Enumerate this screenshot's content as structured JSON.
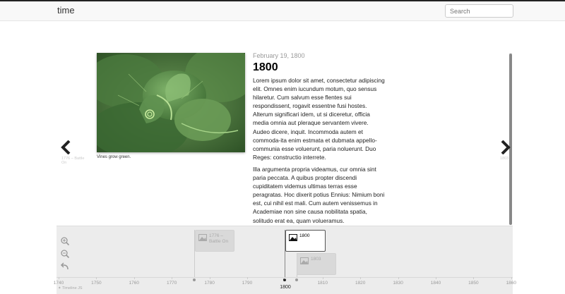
{
  "app": {
    "title": "time"
  },
  "search": {
    "placeholder": "Search"
  },
  "slide": {
    "date": "February 19, 1800",
    "headline": "1800",
    "paragraphs": [
      "Lorem ipsum dolor sit amet, consectetur adipiscing elit. Omnes enim iucundum motum, quo sensus hilaretur. Cum salvum esse flentes sui respondissent, rogavit essentne fusi hostes. Alterum significari idem, ut si diceretur, officia media omnia aut pleraque servantem vivere. Audeo dicere, inquit. Incommoda autem et commoda-ita enim estmata et dubmata appello-communia esse voluerunt, paria noluerunt. Duo Reges: constructio interrete.",
      "Illa argumenta propria videamus, cur omnia sint paria peccata. A quibus propter discendi cupiditatem videmus ultimas terras esse peragratas. Hoc dixerit potius Ennius: Nimium boni est, cui nihil est mali. Cum autem venissemus in Academiae non sine causa nobilitata spatia, solitudo erat ea, quam volueramus."
    ],
    "media_caption": "Vines grow green."
  },
  "navigation": {
    "previous_label": "1776 – Battle On",
    "next_label": "1803"
  },
  "timenav": {
    "tools": [
      "zoom-in-icon",
      "zoom-out-icon",
      "back-to-start-icon"
    ],
    "events": [
      {
        "year": 1776,
        "label": "1776 – Battle On",
        "active": false
      },
      {
        "year": 1800,
        "label": "1800",
        "active": true
      },
      {
        "year": 1803,
        "label": "1803",
        "active": false
      }
    ],
    "axis_ticks": [
      "1740",
      "1750",
      "1760",
      "1770",
      "1780",
      "1790",
      "1800",
      "1810",
      "1820",
      "1830",
      "1840",
      "1850",
      "1860"
    ],
    "current_year": "1800",
    "credit": "Timeline JS"
  },
  "colors": {
    "active_flag_border": "#555555",
    "timenav_background": "#ececec"
  }
}
